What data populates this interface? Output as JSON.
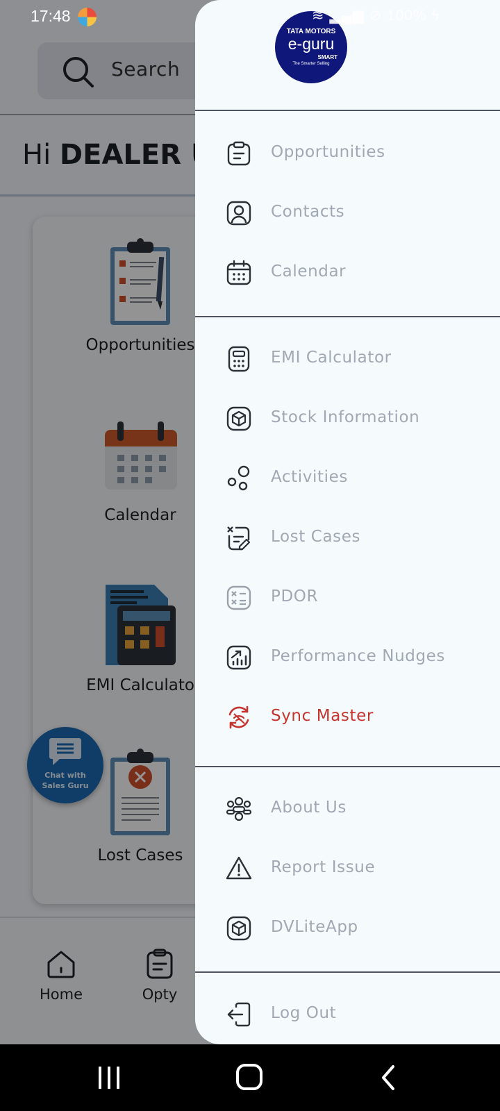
{
  "status": {
    "time": "17:48",
    "battery": "100%"
  },
  "search": {
    "label": "Search"
  },
  "greeting": {
    "prefix": "Hi",
    "name": "DEALER US"
  },
  "dashboard": {
    "tiles": [
      {
        "label": "Opportunities",
        "icon": "clipboard-list-icon"
      },
      {
        "label": "Calendar",
        "icon": "calendar-icon"
      },
      {
        "label": "EMI Calculato",
        "icon": "calculator-icon"
      },
      {
        "label": "Lost Cases",
        "icon": "lost-case-icon"
      }
    ]
  },
  "chat_fab": {
    "line1": "Chat with",
    "line2": "Sales Guru"
  },
  "bottom_nav": {
    "home": "Home",
    "opty": "Opty"
  },
  "drawer": {
    "logo": {
      "brand": "TATA MOTORS",
      "product": "e-guru",
      "tier": "SMART",
      "tagline": "The Smarter Selling"
    },
    "sections": [
      [
        "Opportunities",
        "Contacts",
        "Calendar"
      ],
      [
        "EMI Calculator",
        "Stock Information",
        "Activities",
        "Lost Cases",
        "PDOR",
        "Performance Nudges",
        "Sync Master"
      ],
      [
        "About Us",
        "Report Issue",
        "DVLiteApp"
      ],
      [
        "Log Out"
      ]
    ],
    "accent_color": "#c6342f",
    "muted_text_color": "#a2a8b3"
  }
}
